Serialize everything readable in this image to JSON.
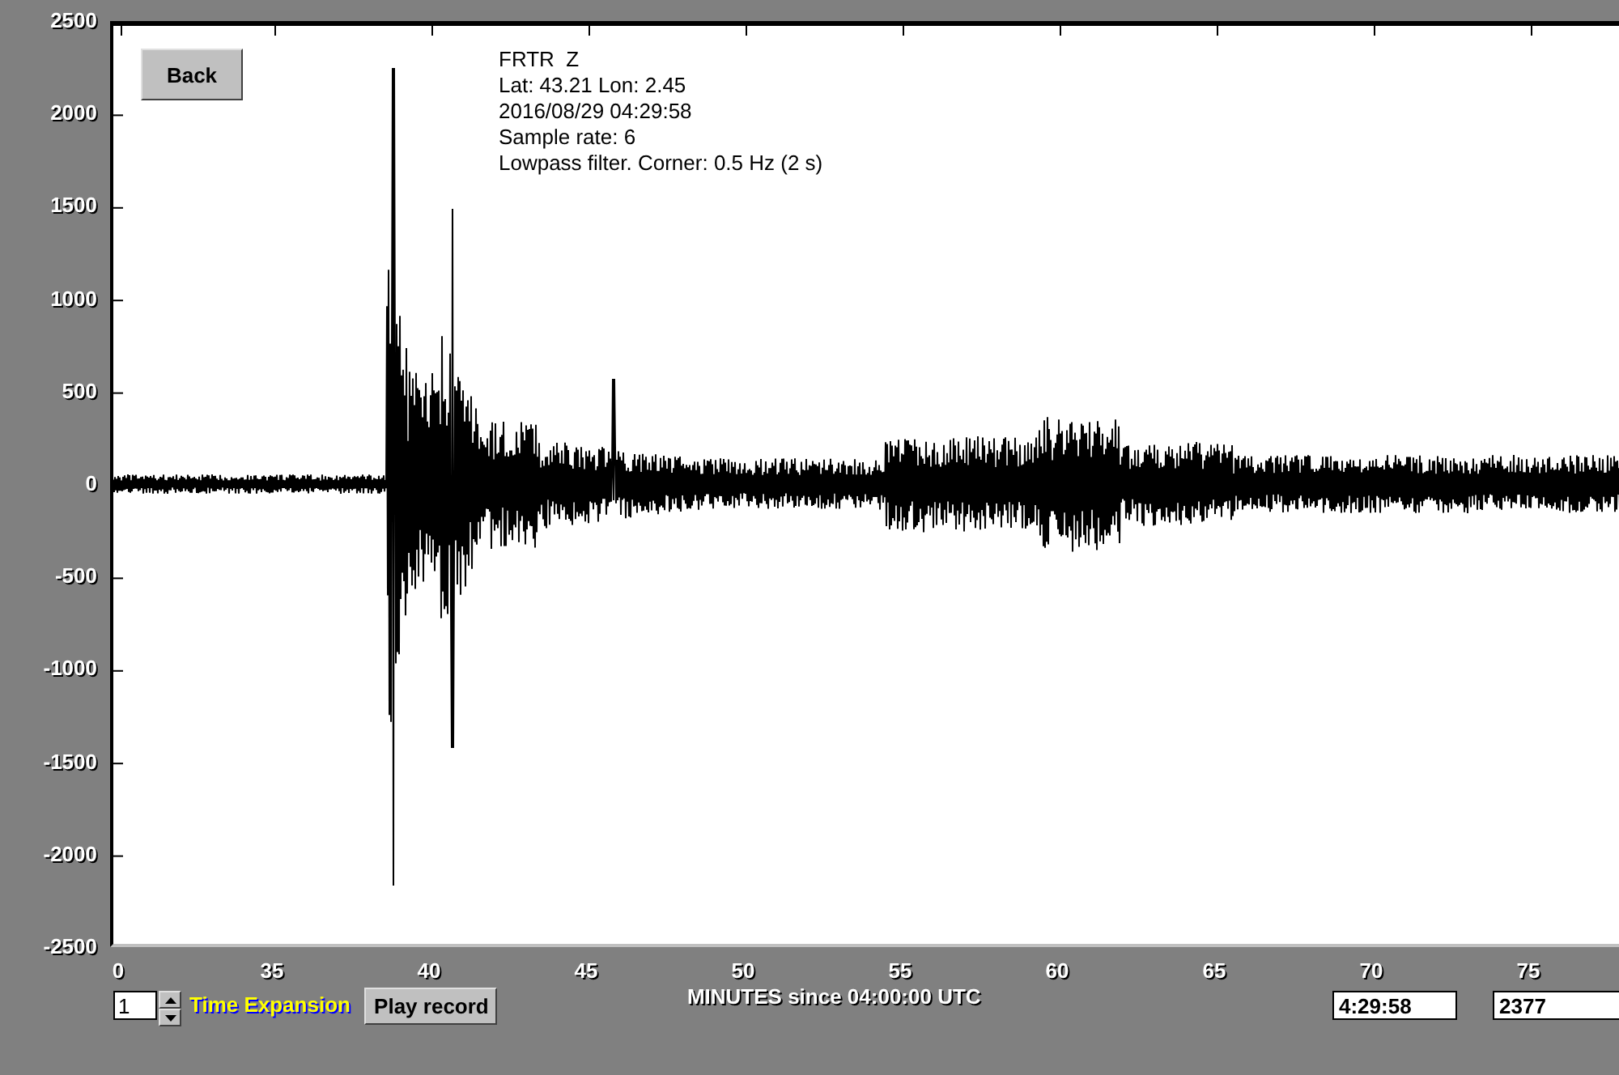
{
  "back_button": "Back",
  "station_info": [
    "FRTR  Z",
    "Lat: 43.21 Lon: 2.45",
    "2016/08/29 04:29:58",
    "Sample rate: 6",
    "Lowpass filter. Corner: 0.5 Hz (2 s)"
  ],
  "y_axis_ticks": [
    "2500",
    "2000",
    "1500",
    "1000",
    "500",
    "0",
    "-500",
    "-1000",
    "-1500",
    "-2000",
    "-2500"
  ],
  "x_axis_ticks": [
    "0",
    "35",
    "40",
    "45",
    "50",
    "55",
    "60",
    "65",
    "70",
    "75"
  ],
  "x_axis_title": "MINUTES since 04:00:00 UTC",
  "time_expansion": {
    "value": "1",
    "label": "Time Expansion"
  },
  "play_button": "Play record",
  "time_field": "4:29:58",
  "value_field": "2377"
}
